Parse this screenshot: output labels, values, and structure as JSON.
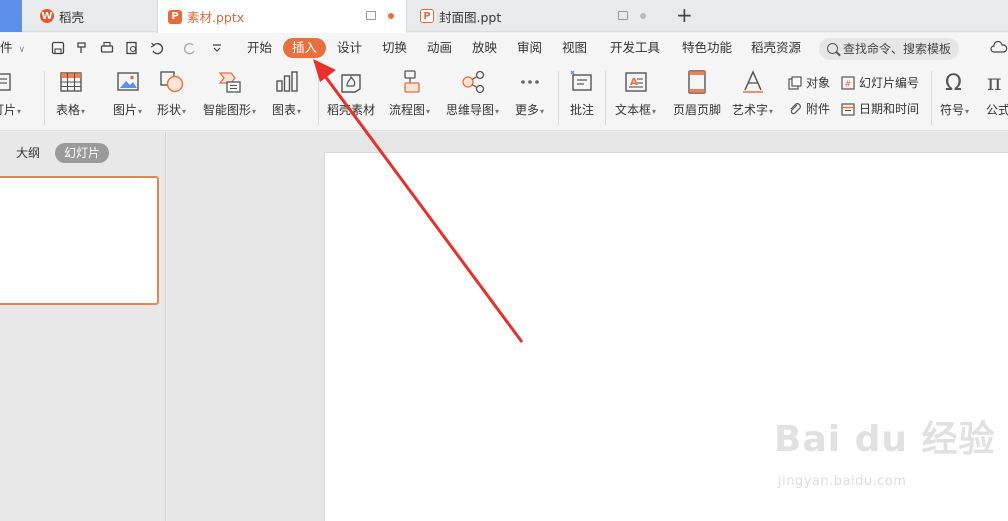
{
  "tabs": [
    {
      "label": "稻壳"
    },
    {
      "label": "素材.pptx"
    },
    {
      "label": "封面图.ppt"
    }
  ],
  "new_tab_label": "+",
  "menu": {
    "file_partial": "件",
    "items": [
      "开始",
      "插入",
      "设计",
      "切换",
      "动画",
      "放映",
      "审阅",
      "视图",
      "开发工具",
      "特色功能",
      "稻壳资源"
    ],
    "active": "插入",
    "search_placeholder": "查找命令、搜索模板"
  },
  "ribbon": {
    "slide_partial": "灯片",
    "table": "表格",
    "image": "图片",
    "shape": "形状",
    "smartart": "智能图形",
    "chart": "图表",
    "docer_material": "稻壳素材",
    "flowchart": "流程图",
    "mindmap": "思维导图",
    "more": "更多",
    "comment": "批注",
    "textbox": "文本框",
    "header_footer": "页眉页脚",
    "wordart": "艺术字",
    "object": "对象",
    "attachment": "附件",
    "slide_number": "幻灯片编号",
    "date_time": "日期和时间",
    "symbol": "符号",
    "formula_partial": "公式"
  },
  "left_pane": {
    "outline_tab": "大纲",
    "slides_tab": "幻灯片"
  },
  "watermark": {
    "brand": "Bai du 经验",
    "url": "jingyan.baidu.com"
  },
  "colors": {
    "accent": "#e8703e",
    "arrow": "#e8302a"
  }
}
